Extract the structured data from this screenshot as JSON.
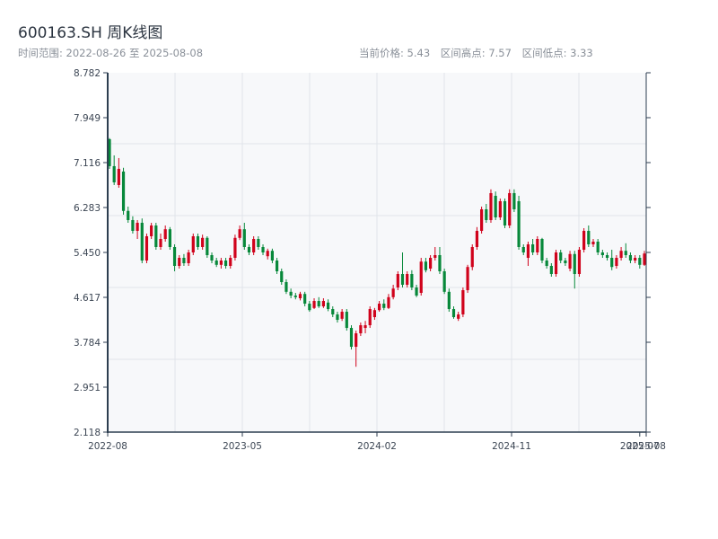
{
  "header": {
    "title": "600163.SH 周K线图",
    "range_label": "时间范围: 2022-08-26 至 2025-08-08",
    "current_price": "当前价格: 5.43",
    "range_high": "区间高点: 7.57",
    "range_low": "区间低点: 3.33"
  },
  "chart_data": {
    "type": "candlestick",
    "title": "600163.SH 周K线图",
    "frequency": "weekly",
    "start_date": "2022-08-26",
    "end_date": "2025-08-08",
    "ylim": [
      2.118,
      8.782
    ],
    "y_ticks": [
      "2.118",
      "2.951",
      "3.784",
      "4.617",
      "5.450",
      "6.283",
      "7.116",
      "7.949",
      "8.782"
    ],
    "x_ticks": [
      "2022-08",
      "2023-05",
      "2024-02",
      "2024-11",
      "2025-07",
      "2025-08"
    ],
    "x_tick_fraction": [
      0,
      0.25,
      0.5,
      0.75,
      0.988,
      1.0
    ],
    "grid": true,
    "colors": {
      "up": "#d0021b",
      "down": "#07883a",
      "plot_bg": "#f7f8fa",
      "grid": "#e1e4ea",
      "axis": "#2d3e50"
    },
    "candle_fields": [
      "open",
      "high",
      "low",
      "close"
    ],
    "candles": [
      [
        7.55,
        7.57,
        7.0,
        7.05
      ],
      [
        7.05,
        7.25,
        6.7,
        6.75
      ],
      [
        6.7,
        7.2,
        6.65,
        7.0
      ],
      [
        6.95,
        7.02,
        6.15,
        6.22
      ],
      [
        6.22,
        6.3,
        6.0,
        6.05
      ],
      [
        6.05,
        6.12,
        5.8,
        5.85
      ],
      [
        5.85,
        6.05,
        5.7,
        6.0
      ],
      [
        6.0,
        6.08,
        5.25,
        5.3
      ],
      [
        5.3,
        5.8,
        5.25,
        5.75
      ],
      [
        5.75,
        6.0,
        5.7,
        5.95
      ],
      [
        5.95,
        6.0,
        5.5,
        5.55
      ],
      [
        5.55,
        5.8,
        5.5,
        5.7
      ],
      [
        5.7,
        5.95,
        5.65,
        5.88
      ],
      [
        5.88,
        5.92,
        5.5,
        5.55
      ],
      [
        5.55,
        5.6,
        5.1,
        5.2
      ],
      [
        5.2,
        5.4,
        5.15,
        5.35
      ],
      [
        5.35,
        5.42,
        5.2,
        5.25
      ],
      [
        5.25,
        5.5,
        5.2,
        5.45
      ],
      [
        5.45,
        5.8,
        5.4,
        5.75
      ],
      [
        5.75,
        5.8,
        5.5,
        5.55
      ],
      [
        5.55,
        5.78,
        5.5,
        5.72
      ],
      [
        5.72,
        5.75,
        5.35,
        5.4
      ],
      [
        5.4,
        5.45,
        5.25,
        5.3
      ],
      [
        5.3,
        5.35,
        5.18,
        5.22
      ],
      [
        5.22,
        5.35,
        5.15,
        5.3
      ],
      [
        5.3,
        5.35,
        5.15,
        5.2
      ],
      [
        5.2,
        5.4,
        5.15,
        5.35
      ],
      [
        5.35,
        5.78,
        5.3,
        5.72
      ],
      [
        5.72,
        5.95,
        5.68,
        5.88
      ],
      [
        5.88,
        6.0,
        5.5,
        5.55
      ],
      [
        5.55,
        5.6,
        5.4,
        5.45
      ],
      [
        5.45,
        5.75,
        5.4,
        5.7
      ],
      [
        5.7,
        5.75,
        5.5,
        5.55
      ],
      [
        5.55,
        5.6,
        5.4,
        5.45
      ],
      [
        5.38,
        5.52,
        5.32,
        5.48
      ],
      [
        5.48,
        5.52,
        5.25,
        5.3
      ],
      [
        5.3,
        5.35,
        5.05,
        5.1
      ],
      [
        5.1,
        5.15,
        4.85,
        4.9
      ],
      [
        4.9,
        4.95,
        4.68,
        4.72
      ],
      [
        4.72,
        4.78,
        4.6,
        4.65
      ],
      [
        4.65,
        4.7,
        4.58,
        4.62
      ],
      [
        4.6,
        4.72,
        4.56,
        4.68
      ],
      [
        4.68,
        4.72,
        4.45,
        4.5
      ],
      [
        4.5,
        4.55,
        4.35,
        4.38
      ],
      [
        4.42,
        4.6,
        4.4,
        4.55
      ],
      [
        4.55,
        4.62,
        4.42,
        4.45
      ],
      [
        4.45,
        4.6,
        4.42,
        4.55
      ],
      [
        4.52,
        4.58,
        4.36,
        4.4
      ],
      [
        4.4,
        4.45,
        4.25,
        4.3
      ],
      [
        4.3,
        4.35,
        4.15,
        4.2
      ],
      [
        4.22,
        4.4,
        4.18,
        4.35
      ],
      [
        4.35,
        4.4,
        4.0,
        4.05
      ],
      [
        4.05,
        4.1,
        3.65,
        3.7
      ],
      [
        3.7,
        4.0,
        3.33,
        3.95
      ],
      [
        3.95,
        4.15,
        3.9,
        4.1
      ],
      [
        4.05,
        4.18,
        3.95,
        4.1
      ],
      [
        4.1,
        4.45,
        4.05,
        4.4
      ],
      [
        4.25,
        4.42,
        4.2,
        4.38
      ],
      [
        4.38,
        4.55,
        4.35,
        4.5
      ],
      [
        4.5,
        4.58,
        4.38,
        4.42
      ],
      [
        4.42,
        4.68,
        4.4,
        4.62
      ],
      [
        4.62,
        4.85,
        4.58,
        4.78
      ],
      [
        4.8,
        5.1,
        4.75,
        5.05
      ],
      [
        5.05,
        5.45,
        4.8,
        4.85
      ],
      [
        4.85,
        5.1,
        4.8,
        5.05
      ],
      [
        5.05,
        5.12,
        4.75,
        4.8
      ],
      [
        4.8,
        4.85,
        4.62,
        4.65
      ],
      [
        4.7,
        5.35,
        4.65,
        5.28
      ],
      [
        5.28,
        5.35,
        5.08,
        5.12
      ],
      [
        5.15,
        5.4,
        5.1,
        5.35
      ],
      [
        5.35,
        5.55,
        5.3,
        5.4
      ],
      [
        5.4,
        5.55,
        5.05,
        5.1
      ],
      [
        5.1,
        5.15,
        4.68,
        4.72
      ],
      [
        4.72,
        4.78,
        4.35,
        4.4
      ],
      [
        4.4,
        4.45,
        4.22,
        4.25
      ],
      [
        4.22,
        4.35,
        4.18,
        4.3
      ],
      [
        4.3,
        4.8,
        4.25,
        4.75
      ],
      [
        4.75,
        5.22,
        4.7,
        5.18
      ],
      [
        5.18,
        5.6,
        5.12,
        5.55
      ],
      [
        5.55,
        5.92,
        5.5,
        5.85
      ],
      [
        5.85,
        6.3,
        5.8,
        6.25
      ],
      [
        6.25,
        6.35,
        6.0,
        6.05
      ],
      [
        6.05,
        6.62,
        6.0,
        6.55
      ],
      [
        6.5,
        6.58,
        6.05,
        6.1
      ],
      [
        6.1,
        6.45,
        6.05,
        6.4
      ],
      [
        6.4,
        6.45,
        5.9,
        5.95
      ],
      [
        5.95,
        6.62,
        5.9,
        6.55
      ],
      [
        6.55,
        6.62,
        6.2,
        6.25
      ],
      [
        6.4,
        6.5,
        5.5,
        5.55
      ],
      [
        5.55,
        5.6,
        5.4,
        5.45
      ],
      [
        5.35,
        5.65,
        5.2,
        5.6
      ],
      [
        5.6,
        5.7,
        5.4,
        5.45
      ],
      [
        5.45,
        5.75,
        5.4,
        5.7
      ],
      [
        5.7,
        5.72,
        5.25,
        5.3
      ],
      [
        5.3,
        5.35,
        5.15,
        5.2
      ],
      [
        5.2,
        5.25,
        5.0,
        5.05
      ],
      [
        5.05,
        5.5,
        5.0,
        5.45
      ],
      [
        5.45,
        5.5,
        5.25,
        5.3
      ],
      [
        5.3,
        5.35,
        5.2,
        5.25
      ],
      [
        5.15,
        5.48,
        5.1,
        5.42
      ],
      [
        5.42,
        5.48,
        4.78,
        5.05
      ],
      [
        5.05,
        5.55,
        5.0,
        5.5
      ],
      [
        5.5,
        5.9,
        5.45,
        5.85
      ],
      [
        5.85,
        5.95,
        5.55,
        5.6
      ],
      [
        5.6,
        5.7,
        5.55,
        5.65
      ],
      [
        5.65,
        5.7,
        5.4,
        5.45
      ],
      [
        5.45,
        5.5,
        5.35,
        5.4
      ],
      [
        5.4,
        5.45,
        5.3,
        5.35
      ],
      [
        5.35,
        5.5,
        5.12,
        5.18
      ],
      [
        5.2,
        5.4,
        5.15,
        5.35
      ],
      [
        5.35,
        5.55,
        5.3,
        5.48
      ],
      [
        5.48,
        5.62,
        5.35,
        5.4
      ],
      [
        5.4,
        5.45,
        5.25,
        5.3
      ],
      [
        5.3,
        5.4,
        5.25,
        5.35
      ],
      [
        5.35,
        5.4,
        5.15,
        5.22
      ],
      [
        5.22,
        5.48,
        5.2,
        5.43
      ]
    ]
  }
}
